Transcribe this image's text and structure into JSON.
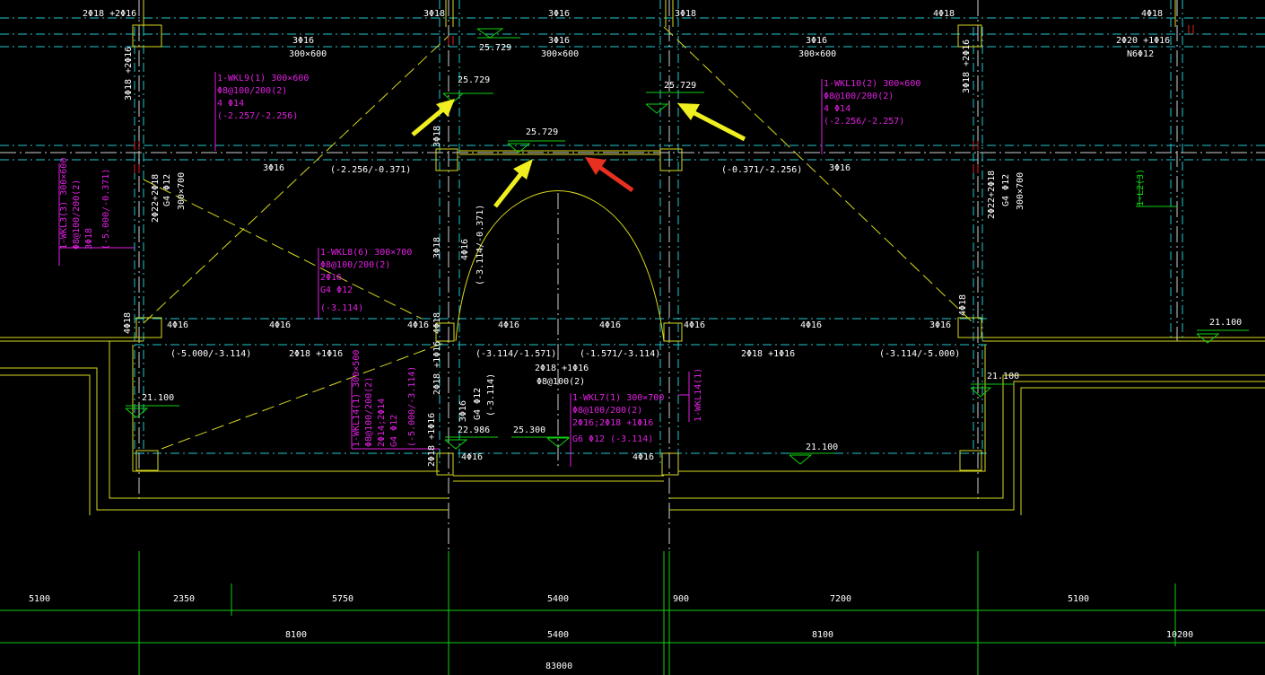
{
  "labels": {
    "r1": "2Φ18 +2Φ16",
    "r2": "3Φ18",
    "r3": "3Φ16",
    "r4": "3Φ18",
    "r5": "4Φ18",
    "r6": "4Φ18",
    "b1a": "3Φ16",
    "b1b": "300×600",
    "b2a": "3Φ16",
    "b2b": "300×600",
    "b3a": "3Φ16",
    "b3b": "300×600",
    "b4a": "2Φ20 +1Φ16",
    "b4b": "N6Φ12",
    "c1": "3Φ18 +2Φ16",
    "c2": "3Φ18 +2Φ16",
    "mid1": "3Φ16",
    "mid2": "(-2.256/-0.371)",
    "mid3": "(-0.371/-2.256)",
    "mid4": "3Φ16",
    "v1a": "2Φ22+2Φ18",
    "v1b": "G4 Φ12",
    "v1c": "300×700",
    "v2a": "2Φ22+2Φ18",
    "v2b": "G4 Φ12",
    "v2c": "300×700",
    "v3": "3Φ18",
    "v4a": "4Φ16",
    "v4b": "(-3.114/-0.371)",
    "l1": "4Φ16",
    "l2": "4Φ16",
    "l3": "4Φ16",
    "l4": "4Φ16",
    "l5": "4Φ16",
    "l6": "4Φ16",
    "l7": "4Φ16",
    "l8": "4Φ16",
    "l9": "3Φ16",
    "l10": "4Φ18",
    "l11": "4Φ18",
    "l12": "4Φ18",
    "lr1": "(-5.000/-3.114)",
    "lr2": "2Φ18 +1Φ16",
    "lr3": "(-3.114/-1.571)",
    "lr4": "(-1.571/-3.114)",
    "lr5": "2Φ18 +1Φ16",
    "lr6": "(-3.114/-5.000)",
    "cm1": "2Φ18 +1Φ16",
    "cm2": "Φ8@100(2)",
    "vb1": "2Φ18 +1Φ16",
    "vb2": "3Φ16",
    "vb3": "G4 Φ12",
    "vb4": "(-3.114)",
    "vb5": "2Φ18 +1Φ16",
    "bot1": "4Φ16",
    "bot2": "4Φ16",
    "e1": "25.729",
    "e2": "25.729",
    "e3": "25.729",
    "e4": "25.729",
    "e5": "21.100",
    "e6": "21.100",
    "e7": "21.100",
    "e8": "21.100",
    "e9": "22.986",
    "e10": "25.300",
    "g1": "1-L2(3)"
  },
  "annotations": {
    "wkl9": [
      "1-WKL9(1) 300×600",
      "Φ8@100/200(2)",
      "4 Φ14",
      "(-2.257/-2.256)"
    ],
    "wkl10": [
      "1-WKL10(2) 300×600",
      "Φ8@100/200(2)",
      "4 Φ14",
      "(-2.256/-2.257)"
    ],
    "wkl3": [
      "1-WKL3(3) 300×600",
      "Φ8@100/200(2)",
      "3Φ18",
      "(-5.000/-0.371)"
    ],
    "wkl8": [
      "1-WKL8(6) 300×700",
      "Φ8@100/200(2)",
      "2Φ16",
      "G4 Φ12",
      "(-3.114)"
    ],
    "wkl14a": [
      "1-WKL14(1) 300×500",
      "Φ8@100/200(2)",
      "2Φ14;2Φ14",
      "G4 Φ12",
      "(-5.000/-3.114)"
    ],
    "wkl7": [
      "1-WKL7(1) 300×700",
      "Φ8@100/200(2)",
      "2Φ16;2Φ18 +1Φ16",
      "G6 Φ12   (-3.114)"
    ],
    "wkl14b": "1-WKL14(1)"
  },
  "dimensions": {
    "row1": [
      "5100",
      "2350",
      "5750",
      "5400",
      "900",
      "7200",
      "5100"
    ],
    "row2": [
      "8100",
      "5400",
      "8100",
      "10200"
    ],
    "total": "83000"
  },
  "colors": {
    "background": "#000000",
    "axis": "#20c8d0",
    "beam": "#d8d820",
    "annotation": "#e020e0",
    "dimension": "#10d010",
    "text": "#ffffff",
    "arrow_yellow": "#f0f020",
    "arrow_red": "#e83020"
  }
}
